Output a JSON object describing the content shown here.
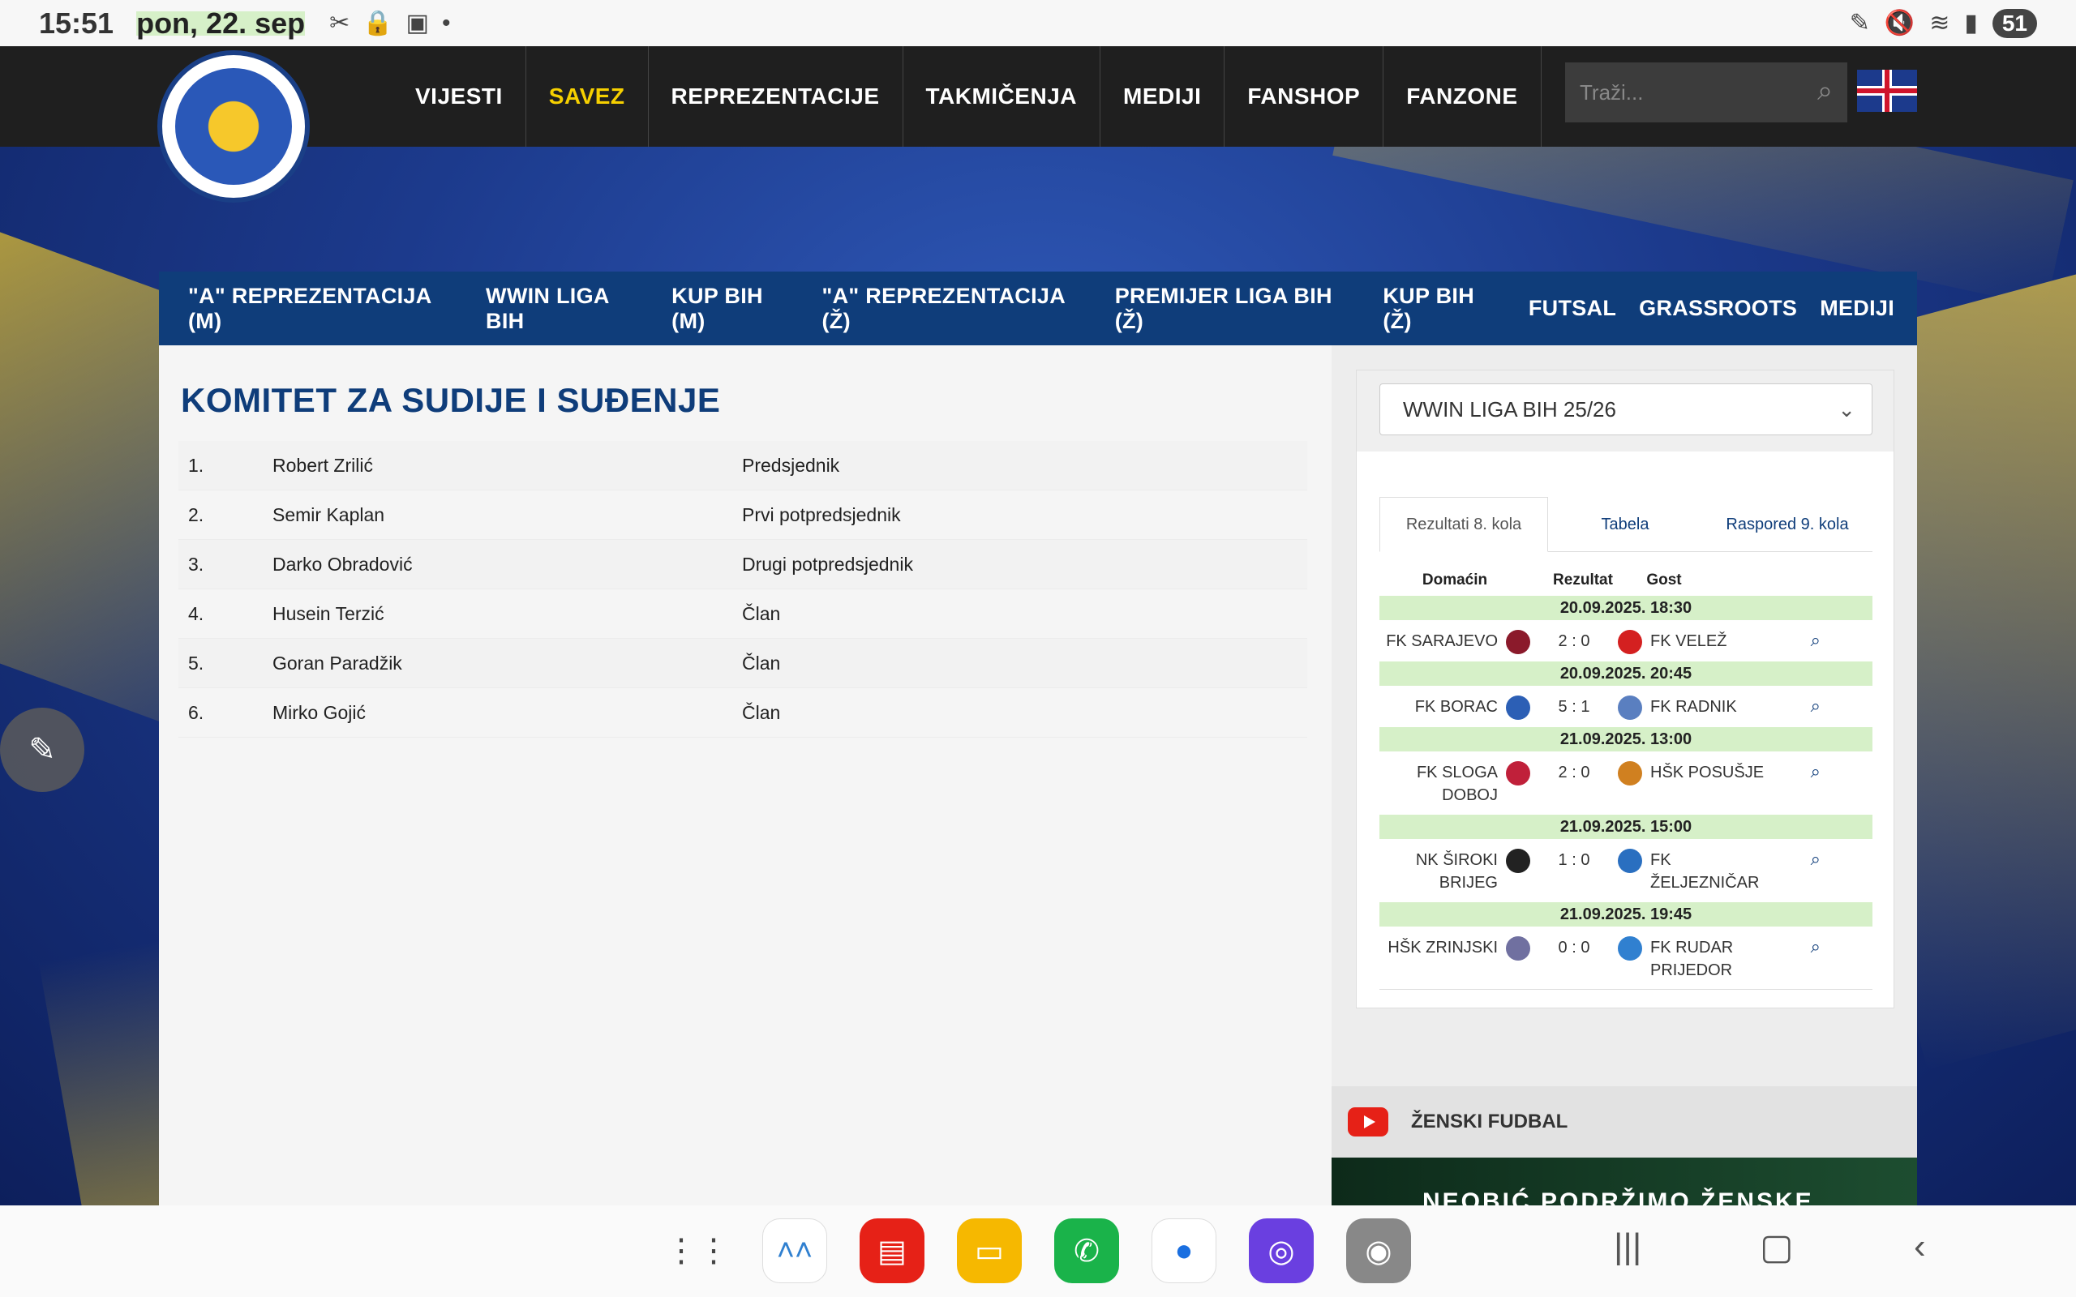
{
  "status": {
    "time": "15:51",
    "date": "pon, 22. sep",
    "battery": "51"
  },
  "nav": {
    "items": [
      "VIJESTI",
      "SAVEZ",
      "REPREZENTACIJE",
      "TAKMIČENJA",
      "MEDIJI",
      "FANSHOP",
      "FANZONE"
    ],
    "active": "SAVEZ",
    "search_placeholder": "Traži..."
  },
  "subnav": {
    "items": [
      "\"A\" REPREZENTACIJA (M)",
      "WWIN LIGA BIH",
      "KUP BIH (M)",
      "\"A\" REPREZENTACIJA (Ž)",
      "PREMIJER LIGA BIH (Ž)",
      "KUP BIH (Ž)",
      "FUTSAL",
      "GRASSROOTS",
      "MEDIJI"
    ]
  },
  "main": {
    "title": "KOMITET ZA SUDIJE I SUĐENJE",
    "members": [
      {
        "num": "1.",
        "name": "Robert Zrilić",
        "role": "Predsjednik"
      },
      {
        "num": "2.",
        "name": "Semir Kaplan",
        "role": "Prvi potpredsjednik"
      },
      {
        "num": "3.",
        "name": "Darko Obradović",
        "role": "Drugi potpredsjednik"
      },
      {
        "num": "4.",
        "name": "Husein Terzić",
        "role": "Član"
      },
      {
        "num": "5.",
        "name": "Goran Paradžik",
        "role": "Član"
      },
      {
        "num": "6.",
        "name": "Mirko Gojić",
        "role": "Član"
      }
    ]
  },
  "sidebar": {
    "league_select": "WWIN LIGA BIH 25/26",
    "tabs": [
      "Rezultati 8. kola",
      "Tabela",
      "Raspored 9. kola"
    ],
    "headers": {
      "home": "Domaćin",
      "score": "Rezultat",
      "away": "Gost"
    },
    "matches": [
      {
        "date": "20.09.2025. 18:30",
        "home": "FK SARAJEVO",
        "score": "2 : 0",
        "away": "FK VELEŽ",
        "hc": "#8b1a2b",
        "ac": "#d42020"
      },
      {
        "date": "20.09.2025. 20:45",
        "home": "FK BORAC",
        "score": "5 : 1",
        "away": "FK RADNIK",
        "hc": "#2c5fb5",
        "ac": "#5a7fc0"
      },
      {
        "date": "21.09.2025. 13:00",
        "home": "FK SLOGA DOBOJ",
        "score": "2 : 0",
        "away": "HŠK POSUŠJE",
        "hc": "#c0203a",
        "ac": "#d08020"
      },
      {
        "date": "21.09.2025. 15:00",
        "home": "NK ŠIROKI BRIJEG",
        "score": "1 : 0",
        "away": "FK ŽELJEZNIČAR",
        "hc": "#222222",
        "ac": "#2a6fc0"
      },
      {
        "date": "21.09.2025. 19:45",
        "home": "HŠK ZRINJSKI",
        "score": "0 : 0",
        "away": "FK RUDAR PRIJEDOR",
        "hc": "#7070a0",
        "ac": "#3080d0"
      }
    ],
    "youtube_title": "ŽENSKI FUDBAL",
    "video_text": "NEOBIĆ  PODRŽIMO ŽENSKE"
  }
}
